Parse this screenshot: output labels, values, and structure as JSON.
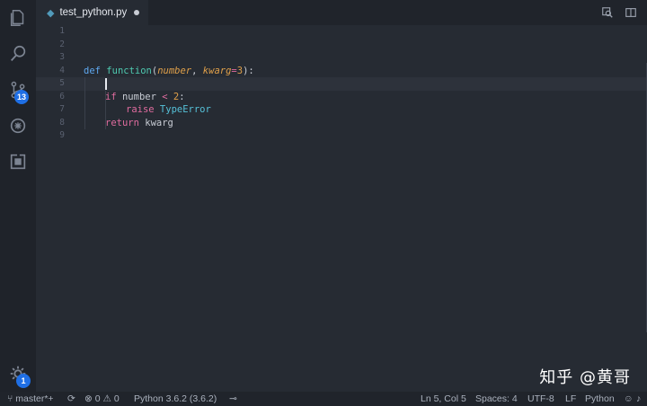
{
  "activity_bar": {
    "items": [
      {
        "name": "explorer",
        "icon": "files-icon"
      },
      {
        "name": "search",
        "icon": "search-icon"
      },
      {
        "name": "source-control",
        "icon": "source-control-icon",
        "badge": "13"
      },
      {
        "name": "debug",
        "icon": "debug-icon"
      },
      {
        "name": "extensions",
        "icon": "extensions-icon"
      }
    ],
    "settings_badge": "1"
  },
  "tab": {
    "icon": "python-file-icon",
    "title": "test_python.py",
    "modified": true
  },
  "editor": {
    "line_numbers": [
      "1",
      "2",
      "3",
      "4",
      "5",
      "6",
      "7",
      "8",
      "9"
    ],
    "current_line": 5,
    "code": {
      "l4": {
        "def": "def",
        "fn": "function",
        "paren_open": "(",
        "p1": "number",
        "comma": ", ",
        "p2": "kwarg",
        "eq": "=",
        "val": "3",
        "close": "):"
      },
      "l6": {
        "if": "if",
        "var": " number ",
        "op": "<",
        "num": " 2",
        "colon": ":"
      },
      "l7": {
        "raise": "raise",
        "exc": " TypeError"
      },
      "l8": {
        "ret": "return",
        "var": " kwarg"
      }
    }
  },
  "watermark": "知乎 @黄哥",
  "status_bar": {
    "branch": "master*+",
    "errors": "0",
    "warnings": "0",
    "interpreter": "Python 3.6.2 (3.6.2)",
    "position": "Ln 5, Col 5",
    "spaces": "Spaces: 4",
    "encoding": "UTF-8",
    "eol": "LF",
    "language": "Python"
  },
  "colors": {
    "background": "#262b33",
    "activity_bar": "#1f232a",
    "badge": "#1f6fe5",
    "keyword": "#5fa8f0",
    "function": "#4ec9b0",
    "parameter": "#e0a04a",
    "operator": "#e06c9f"
  }
}
